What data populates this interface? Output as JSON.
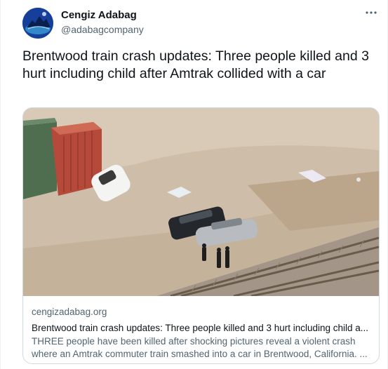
{
  "author": {
    "display_name": "Cengiz Adabag",
    "handle": "@adabagcompany",
    "avatar_icon": "avatar-image"
  },
  "more_icon": "more-options-icon",
  "tweet": {
    "text": "Brentwood train crash updates: Three people killed and 3 hurt including child after Amtrak collided with a car"
  },
  "card": {
    "domain": "cengizadabag.org",
    "title": "Brentwood train crash updates: Three people killed and 3 hurt including child a...",
    "description": "THREE people have been killed after shocking pictures reveal a violent crash where an Amtrak commuter train smashed into a car in Brentwood, California. ..."
  },
  "colors": {
    "text_primary": "#0f1419",
    "text_secondary": "#536471",
    "border": "#cfd9de"
  }
}
